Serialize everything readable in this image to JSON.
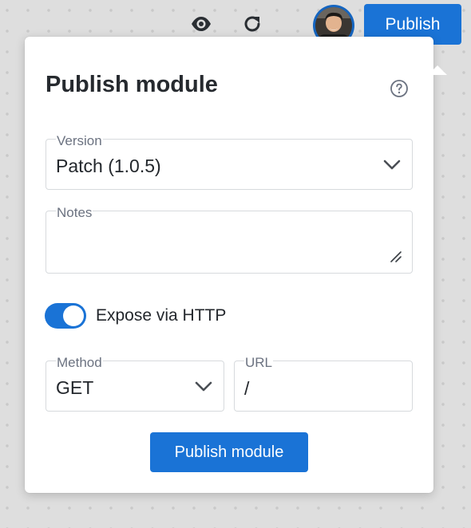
{
  "topbar": {
    "preview_icon": "eye-icon",
    "refresh_icon": "refresh-icon",
    "publish_label": "Publish"
  },
  "popover": {
    "title": "Publish module",
    "help_icon": "question-circle-icon",
    "version": {
      "label": "Version",
      "selected": "Patch (1.0.5)"
    },
    "notes": {
      "label": "Notes",
      "value": ""
    },
    "expose_http": {
      "label": "Expose via HTTP",
      "enabled": true
    },
    "method": {
      "label": "Method",
      "selected": "GET"
    },
    "url": {
      "label": "URL",
      "value": "/"
    },
    "submit_label": "Publish module"
  },
  "colors": {
    "accent": "#1a73d6",
    "background": "#dedede",
    "border": "#d7dadd"
  }
}
